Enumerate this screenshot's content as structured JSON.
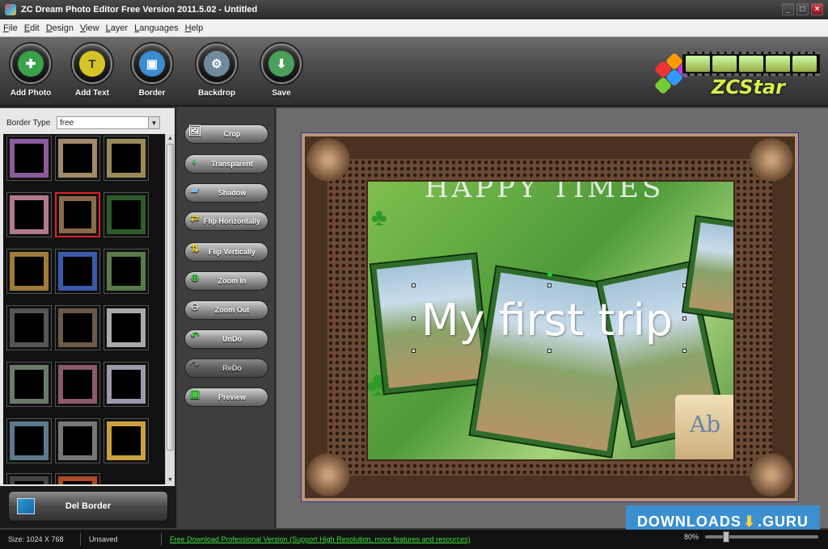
{
  "window": {
    "title": "ZC Dream Photo Editor Free Version 2011.5.02 - Untitled"
  },
  "menu": [
    "File",
    "Edit",
    "Design",
    "View",
    "Layer",
    "Languages",
    "Help"
  ],
  "toolbar": {
    "tools": [
      {
        "label": "Add Photo",
        "icon": "add-photo-icon",
        "color": "#3aa24a"
      },
      {
        "label": "Add Text",
        "icon": "add-text-icon",
        "color": "#d6c327"
      },
      {
        "label": "Border",
        "icon": "border-icon",
        "color": "#3b8cd1"
      },
      {
        "label": "Backdrop",
        "icon": "backdrop-icon",
        "color": "#6f8a9a"
      },
      {
        "label": "Save",
        "icon": "save-icon",
        "color": "#4aa05a"
      }
    ],
    "brand": "ZCStar"
  },
  "left_panel": {
    "border_type_label": "Border Type",
    "border_type_value": "free",
    "del_border_label": "Del Border"
  },
  "edit_panel": {
    "buttons": [
      {
        "label": "Crop",
        "icon": "crop-icon",
        "enabled": true
      },
      {
        "label": "Transparent",
        "icon": "transparent-icon",
        "enabled": true
      },
      {
        "label": "Shadow",
        "icon": "shadow-icon",
        "enabled": true
      },
      {
        "label": "Flip Horizontally",
        "icon": "flip-horizontal-icon",
        "enabled": true
      },
      {
        "label": "Flip Vertically",
        "icon": "flip-vertical-icon",
        "enabled": true
      },
      {
        "label": "Zoom In",
        "icon": "zoom-in-icon",
        "enabled": true
      },
      {
        "label": "Zoom Out",
        "icon": "zoom-out-icon",
        "enabled": true
      },
      {
        "label": "UnDo",
        "icon": "undo-icon",
        "enabled": true
      },
      {
        "label": "ReDo",
        "icon": "redo-icon",
        "enabled": false
      },
      {
        "label": "Preview",
        "icon": "preview-icon",
        "enabled": true
      }
    ]
  },
  "canvas": {
    "caption": "My first trip",
    "header_text": "HAPPY TIMES",
    "book_text": "Ab"
  },
  "status": {
    "size": "Size: 1024 X 768",
    "saved": "Unsaved",
    "promo": "Free Download Professional Version (Support High Resolution, more features and resources)",
    "zoom": "80%"
  },
  "watermark": {
    "left": "DOWNLOADS",
    "right": "GURU"
  }
}
